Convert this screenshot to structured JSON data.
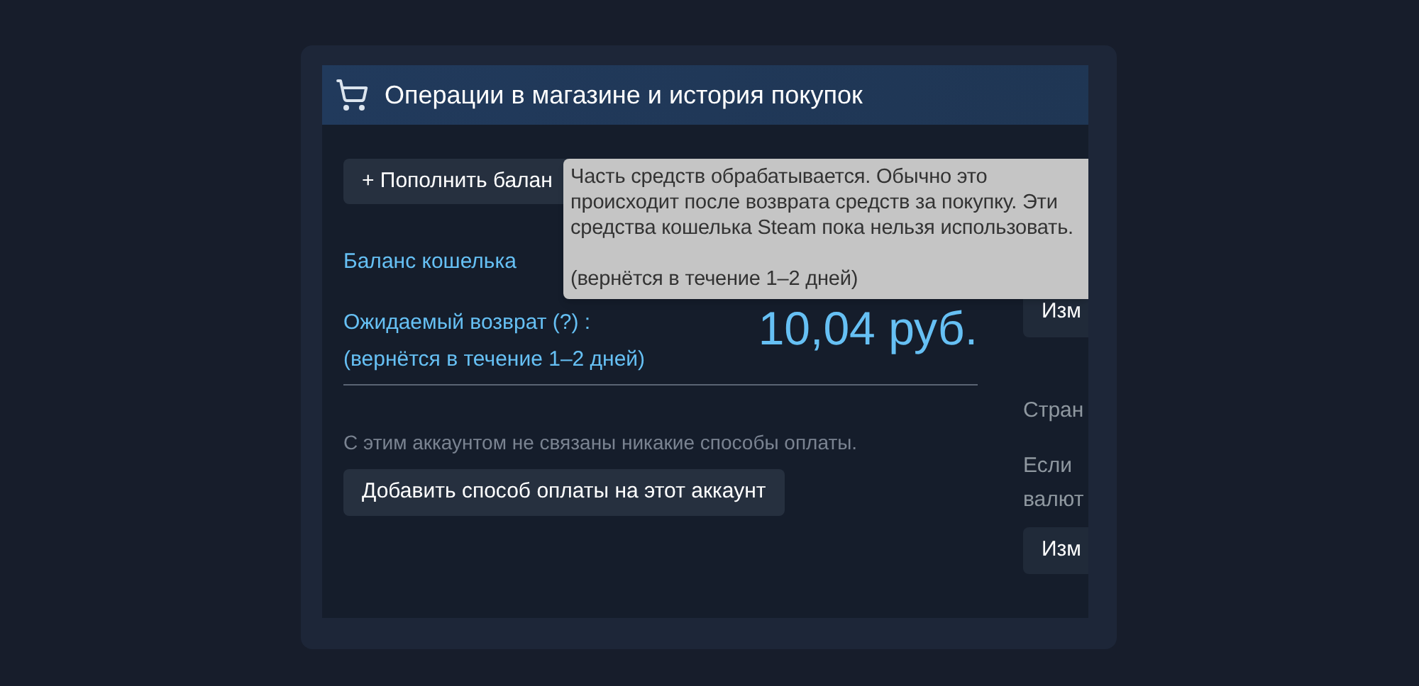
{
  "header": {
    "title": "Операции в магазине и история покупок"
  },
  "topup_button": "+ Пополнить балан",
  "tooltip": {
    "text": "Часть средств обрабатывается. Обычно это происходит после возврата средств за покупку. Эти средства кошелька Steam пока нельзя использовать.",
    "note": "(вернётся в течение 1–2 дней)"
  },
  "wallet_label": "Баланс кошелька",
  "pending": {
    "label": "Ожидаемый возврат (?) :",
    "note": "(вернётся в течение 1–2 дней)",
    "amount": "10,04 руб."
  },
  "payment": {
    "message": "С этим аккаунтом не связаны никакие способы оплаты.",
    "button": "Добавить способ оплаты на этот аккаунт"
  },
  "right_column": {
    "button_1": "Изм",
    "country_label": "Стран",
    "text_lines": [
      "Если",
      "валют"
    ],
    "button_2": "Изм"
  }
}
